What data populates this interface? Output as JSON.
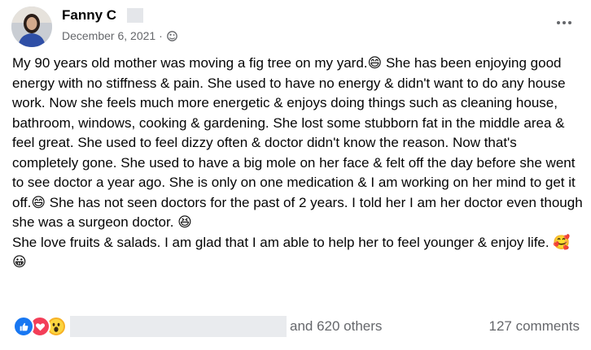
{
  "post": {
    "author": "Fanny C",
    "date": "December 6, 2021 ·",
    "privacy_icon": "public-globe-icon",
    "more_icon": "more-options-icon",
    "paragraphs": [
      "My 90 years old mother was moving a fig tree on my yard.😄 She has been enjoying good  energy with no stiffness & pain. She used to have no energy & didn't want to do any house work. Now she feels much more energetic & enjoys doing things such as cleaning house, bathroom, windows, cooking & gardening. She lost some stubborn fat in the middle area & feel great. She used to feel dizzy often & doctor didn't know the reason. Now that's completely gone. She used to have a big mole on her face & felt off the day before she went to see doctor a year ago. She is only on one medication & I am working on her mind to get it off.😄 She has not seen doctors for the past of 2 years. I told her I am her doctor even though she was a surgeon doctor. 😆",
      "She love fruits & salads. I am glad that I am able to help her to feel younger & enjoy life. 🥰😀"
    ]
  },
  "footer": {
    "reaction_icons": [
      "like-reaction-icon",
      "love-reaction-icon",
      "wow-reaction-icon"
    ],
    "others_text": "and 620 others",
    "comments_text": "127 comments"
  },
  "colors": {
    "like": "#1877f2",
    "love": "#f33e58",
    "wow": "#f7b125",
    "secondary_text": "#65676b"
  }
}
